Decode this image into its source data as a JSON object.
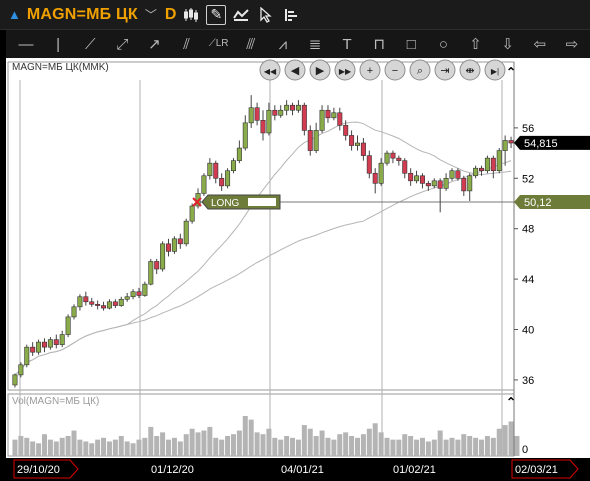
{
  "header": {
    "symbol": "MAGN=МБ ЦК",
    "interval": "D"
  },
  "toolbar_icons": [
    "candles-icon",
    "draw-icon",
    "indicators-icon",
    "cursor-icon",
    "layout-icon"
  ],
  "draw_tools": [
    "hline-icon",
    "vline-icon",
    "trendline-icon",
    "ray-icon",
    "arrow-icon",
    "parallel-icon",
    "linreg-icon",
    "fan-icon",
    "pitchfork-icon",
    "fib-icon",
    "text-icon",
    "ruler-icon",
    "rectangle-icon",
    "ellipse-icon",
    "arrow-up-icon",
    "arrow-down-icon",
    "arrow-left-icon",
    "arrow-right-icon"
  ],
  "chart": {
    "title": "MAGN=МБ ЦК(MMK)",
    "last_price_label": "54,815",
    "long_price_label": "50,12",
    "long_text": "LONG",
    "volume_title": "Vol(MAGN=МБ ЦК)",
    "volume_zero": "0",
    "colors": {
      "up": "#8aab4a",
      "down": "#d23c50",
      "long": "#6e7c3a",
      "last": "#000000"
    }
  },
  "nav_buttons": [
    "rewind-icon",
    "back-icon",
    "forward-icon",
    "fast-forward-icon",
    "zoom-in-icon",
    "zoom-out-icon",
    "zoom-fit-icon",
    "compress-icon",
    "expand-icon",
    "to-end-icon"
  ],
  "x_labels": [
    {
      "text": "29/10/20",
      "style": "edge"
    },
    {
      "text": "01/12/20",
      "style": "plain"
    },
    {
      "text": "04/01/21",
      "style": "plain"
    },
    {
      "text": "01/02/21",
      "style": "plain"
    },
    {
      "text": "02/03/21",
      "style": "edge-end"
    }
  ],
  "chart_data": {
    "type": "candlestick",
    "y_ticks": [
      36,
      40,
      44,
      48,
      52,
      56
    ],
    "ylim": [
      35.2,
      59.8
    ],
    "last_price": 54.815,
    "long_level": 50.12,
    "candles": [
      [
        35.6,
        36.4,
        35.4,
        36.5
      ],
      [
        36.4,
        37.2,
        36.2,
        37.4
      ],
      [
        37.2,
        38.6,
        37.0,
        38.8
      ],
      [
        38.6,
        38.2,
        37.9,
        39.0
      ],
      [
        38.2,
        39.0,
        38.0,
        39.2
      ],
      [
        39.0,
        38.6,
        38.2,
        39.3
      ],
      [
        38.6,
        39.2,
        38.4,
        39.4
      ],
      [
        39.2,
        38.8,
        38.5,
        39.6
      ],
      [
        38.8,
        39.6,
        38.6,
        39.9
      ],
      [
        39.6,
        41.0,
        39.4,
        41.2
      ],
      [
        41.0,
        41.8,
        40.8,
        42.0
      ],
      [
        41.8,
        42.6,
        41.5,
        42.8
      ],
      [
        42.6,
        42.2,
        41.9,
        43.0
      ],
      [
        42.2,
        42.0,
        41.8,
        42.5
      ],
      [
        42.0,
        41.9,
        41.6,
        42.3
      ],
      [
        41.9,
        41.7,
        41.5,
        42.2
      ],
      [
        41.7,
        42.2,
        41.6,
        42.4
      ],
      [
        42.2,
        41.9,
        41.7,
        42.4
      ],
      [
        41.9,
        42.4,
        41.8,
        42.6
      ],
      [
        42.4,
        42.6,
        42.2,
        42.9
      ],
      [
        42.6,
        43.0,
        42.4,
        43.2
      ],
      [
        43.0,
        42.7,
        42.5,
        43.3
      ],
      [
        42.7,
        43.6,
        42.6,
        43.8
      ],
      [
        43.6,
        45.4,
        43.5,
        45.6
      ],
      [
        45.4,
        44.8,
        44.4,
        45.6
      ],
      [
        44.8,
        46.8,
        44.6,
        47.0
      ],
      [
        46.8,
        46.2,
        45.8,
        47.2
      ],
      [
        46.2,
        47.2,
        46.0,
        47.4
      ],
      [
        47.2,
        46.8,
        46.4,
        47.6
      ],
      [
        46.8,
        48.6,
        46.6,
        48.8
      ],
      [
        48.6,
        49.8,
        48.4,
        50.0
      ],
      [
        49.8,
        50.8,
        49.6,
        51.2
      ],
      [
        50.8,
        52.2,
        50.6,
        52.4
      ],
      [
        52.2,
        53.2,
        51.9,
        53.6
      ],
      [
        53.2,
        52.0,
        51.6,
        53.4
      ],
      [
        52.0,
        51.4,
        51.0,
        52.4
      ],
      [
        51.4,
        52.6,
        51.2,
        52.8
      ],
      [
        52.6,
        53.4,
        52.4,
        53.6
      ],
      [
        53.4,
        54.4,
        53.2,
        55.0
      ],
      [
        54.4,
        56.4,
        54.2,
        57.0
      ],
      [
        56.4,
        57.6,
        56.0,
        58.6
      ],
      [
        57.6,
        56.6,
        56.2,
        58.0
      ],
      [
        56.6,
        55.6,
        55.0,
        57.4
      ],
      [
        55.6,
        57.4,
        55.4,
        58.0
      ],
      [
        57.4,
        57.0,
        56.6,
        57.8
      ],
      [
        57.0,
        57.4,
        56.8,
        57.8
      ],
      [
        57.4,
        57.8,
        57.0,
        58.2
      ],
      [
        57.8,
        57.4,
        57.0,
        58.0
      ],
      [
        57.4,
        57.8,
        57.2,
        58.2
      ],
      [
        57.8,
        55.8,
        55.4,
        58.0
      ],
      [
        55.8,
        54.2,
        53.8,
        56.2
      ],
      [
        54.2,
        55.8,
        54.0,
        56.4
      ],
      [
        55.8,
        57.4,
        55.6,
        57.8
      ],
      [
        57.4,
        56.8,
        56.4,
        57.8
      ],
      [
        56.8,
        57.2,
        56.6,
        57.6
      ],
      [
        57.2,
        56.2,
        55.8,
        57.6
      ],
      [
        56.2,
        55.4,
        55.0,
        56.6
      ],
      [
        55.4,
        54.6,
        54.2,
        55.8
      ],
      [
        54.6,
        54.8,
        54.2,
        55.4
      ],
      [
        54.8,
        53.8,
        53.4,
        55.2
      ],
      [
        53.8,
        52.4,
        52.0,
        54.2
      ],
      [
        52.4,
        51.6,
        50.8,
        52.8
      ],
      [
        51.6,
        53.2,
        51.4,
        53.6
      ],
      [
        53.2,
        54.0,
        53.0,
        54.2
      ],
      [
        54.0,
        53.6,
        53.2,
        54.2
      ],
      [
        53.6,
        53.4,
        53.0,
        53.8
      ],
      [
        53.4,
        52.4,
        52.0,
        53.6
      ],
      [
        52.4,
        51.8,
        51.4,
        52.8
      ],
      [
        51.8,
        52.2,
        51.6,
        52.6
      ],
      [
        52.2,
        51.6,
        51.2,
        52.4
      ],
      [
        51.6,
        51.4,
        51.0,
        51.8
      ],
      [
        51.4,
        51.8,
        51.2,
        52.0
      ],
      [
        51.8,
        51.2,
        49.3,
        52.0
      ],
      [
        51.2,
        52.0,
        51.0,
        52.4
      ],
      [
        52.0,
        52.6,
        51.8,
        52.8
      ],
      [
        52.6,
        52.0,
        51.8,
        52.8
      ],
      [
        52.0,
        51.0,
        50.6,
        52.2
      ],
      [
        51.0,
        52.2,
        50.2,
        52.4
      ],
      [
        52.2,
        52.8,
        52.0,
        53.0
      ],
      [
        52.8,
        52.6,
        52.2,
        53.0
      ],
      [
        52.6,
        53.6,
        52.4,
        53.8
      ],
      [
        53.6,
        52.6,
        52.0,
        53.8
      ],
      [
        52.6,
        54.2,
        52.4,
        54.4
      ],
      [
        54.2,
        55.0,
        53.0,
        55.4
      ],
      [
        55.0,
        54.8,
        54.4,
        55.3
      ]
    ],
    "volumes": [
      9,
      11,
      10,
      8,
      7,
      12,
      9,
      8,
      10,
      11,
      14,
      9,
      8,
      7,
      9,
      10,
      8,
      9,
      11,
      8,
      7,
      9,
      10,
      16,
      11,
      13,
      9,
      10,
      8,
      12,
      15,
      13,
      14,
      16,
      10,
      9,
      11,
      12,
      14,
      22,
      20,
      13,
      12,
      15,
      10,
      9,
      11,
      10,
      9,
      17,
      15,
      11,
      14,
      10,
      9,
      12,
      13,
      11,
      10,
      12,
      15,
      18,
      13,
      10,
      9,
      9,
      12,
      11,
      9,
      10,
      8,
      9,
      14,
      9,
      10,
      9,
      12,
      11,
      10,
      9,
      11,
      10,
      15,
      17,
      19,
      11
    ],
    "volume_ylim": [
      0,
      22
    ]
  }
}
